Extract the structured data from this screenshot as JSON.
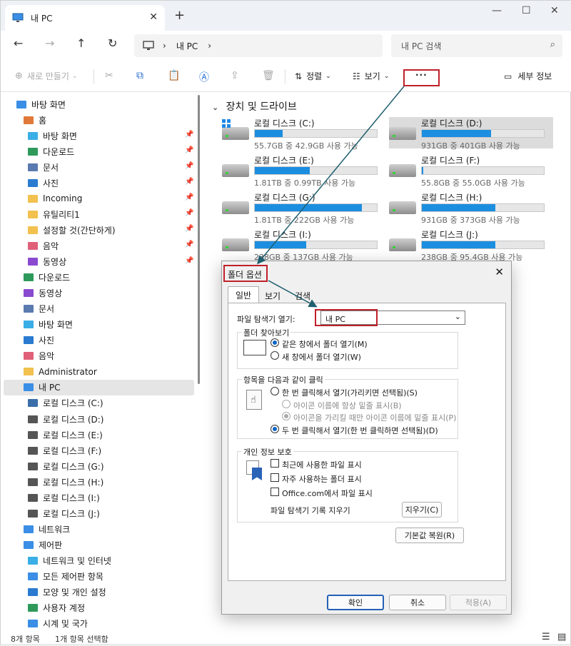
{
  "tab": {
    "title": "내 PC"
  },
  "address": {
    "segments": [
      "내 PC"
    ]
  },
  "search": {
    "placeholder": "내 PC 검색"
  },
  "toolbar": {
    "new": "새로 만들기",
    "sort": "정렬",
    "view": "보기",
    "more": "···",
    "details": "세부 정보"
  },
  "sidebar": {
    "items": [
      {
        "label": "바탕 화면",
        "icon": "desktop-icon",
        "color": "#3a8ee6",
        "indent": 0
      },
      {
        "label": "홈",
        "icon": "home-icon",
        "color": "#e07a3a",
        "indent": 1
      },
      {
        "label": "바탕 화면",
        "icon": "desktop-icon",
        "color": "#3aaee6",
        "indent": 2,
        "pinned": true
      },
      {
        "label": "다운로드",
        "icon": "download-icon",
        "color": "#2e9a5a",
        "indent": 2,
        "pinned": true
      },
      {
        "label": "문서",
        "icon": "document-icon",
        "color": "#5a7ab0",
        "indent": 2,
        "pinned": true
      },
      {
        "label": "사진",
        "icon": "pictures-icon",
        "color": "#2a7ad0",
        "indent": 2,
        "pinned": true
      },
      {
        "label": "Incoming",
        "icon": "folder-icon",
        "color": "#f2c14e",
        "indent": 2,
        "pinned": true
      },
      {
        "label": "유틸리티1",
        "icon": "folder-icon",
        "color": "#f2c14e",
        "indent": 2,
        "pinned": true
      },
      {
        "label": "설정할 것(간단하게)",
        "icon": "folder-icon",
        "color": "#f2c14e",
        "indent": 2,
        "pinned": true
      },
      {
        "label": "음악",
        "icon": "music-icon",
        "color": "#e0607a",
        "indent": 2,
        "pinned": true
      },
      {
        "label": "동영상",
        "icon": "video-icon",
        "color": "#8a4ad0",
        "indent": 2,
        "pinned": true
      },
      {
        "label": "다운로드",
        "icon": "download-icon",
        "color": "#2e9a5a",
        "indent": 1
      },
      {
        "label": "동영상",
        "icon": "video-icon",
        "color": "#8a4ad0",
        "indent": 1
      },
      {
        "label": "문서",
        "icon": "document-icon",
        "color": "#5a7ab0",
        "indent": 1
      },
      {
        "label": "바탕 화면",
        "icon": "desktop-icon",
        "color": "#3aaee6",
        "indent": 1
      },
      {
        "label": "사진",
        "icon": "pictures-icon",
        "color": "#2a7ad0",
        "indent": 1
      },
      {
        "label": "음악",
        "icon": "music-icon",
        "color": "#e0607a",
        "indent": 1
      },
      {
        "label": "Administrator",
        "icon": "folder-icon",
        "color": "#f2c14e",
        "indent": 1
      },
      {
        "label": "내 PC",
        "icon": "pc-icon",
        "color": "#3a8ee6",
        "indent": 1,
        "selected": true
      },
      {
        "label": "로컬 디스크 (C:)",
        "icon": "windows-drive-icon",
        "color": "#3a6ea8",
        "indent": 2
      },
      {
        "label": "로컬 디스크 (D:)",
        "icon": "drive-icon",
        "color": "#555555",
        "indent": 2
      },
      {
        "label": "로컬 디스크 (E:)",
        "icon": "drive-icon",
        "color": "#555555",
        "indent": 2
      },
      {
        "label": "로컬 디스크 (F:)",
        "icon": "drive-icon",
        "color": "#555555",
        "indent": 2
      },
      {
        "label": "로컬 디스크 (G:)",
        "icon": "drive-icon",
        "color": "#555555",
        "indent": 2
      },
      {
        "label": "로컬 디스크 (H:)",
        "icon": "drive-icon",
        "color": "#555555",
        "indent": 2
      },
      {
        "label": "로컬 디스크 (I:)",
        "icon": "drive-icon",
        "color": "#555555",
        "indent": 2
      },
      {
        "label": "로컬 디스크 (J:)",
        "icon": "drive-icon",
        "color": "#555555",
        "indent": 2
      },
      {
        "label": "네트워크",
        "icon": "network-icon",
        "color": "#3a8ee6",
        "indent": 1
      },
      {
        "label": "제어판",
        "icon": "control-panel-icon",
        "color": "#3a8ee6",
        "indent": 1
      },
      {
        "label": "네트워크 및 인터넷",
        "icon": "network-internet-icon",
        "color": "#3aaee6",
        "indent": 2
      },
      {
        "label": "모든 제어판 항목",
        "icon": "control-panel-icon",
        "color": "#3a8ee6",
        "indent": 2
      },
      {
        "label": "모양 및 개인 설정",
        "icon": "appearance-icon",
        "color": "#2a7ad0",
        "indent": 2
      },
      {
        "label": "사용자 계정",
        "icon": "user-accounts-icon",
        "color": "#2e9a5a",
        "indent": 2
      },
      {
        "label": "시계 및 국가",
        "icon": "clock-region-icon",
        "color": "#3a8ee6",
        "indent": 2
      }
    ]
  },
  "main": {
    "section_title": "장치 및 드라이브",
    "drives": [
      {
        "name": "로컬 디스크 (C:)",
        "size": "55.7GB 중 42.9GB 사용 가능",
        "used": 0.23,
        "system": true
      },
      {
        "name": "로컬 디스크 (D:)",
        "size": "931GB 중 401GB 사용 가능",
        "used": 0.57,
        "selected": true
      },
      {
        "name": "로컬 디스크 (E:)",
        "size": "1.81TB 중 0.99TB 사용 가능",
        "used": 0.45
      },
      {
        "name": "로컬 디스크 (F:)",
        "size": "55.8GB 중 55.0GB 사용 가능",
        "used": 0.01
      },
      {
        "name": "로컬 디스크 (G:)",
        "size": "1.81TB 중 222GB 사용 가능",
        "used": 0.88
      },
      {
        "name": "로컬 디스크 (H:)",
        "size": "931GB 중 373GB 사용 가능",
        "used": 0.6
      },
      {
        "name": "로컬 디스크 (I:)",
        "size": "238GB 중 137GB 사용 가능",
        "used": 0.42
      },
      {
        "name": "로컬 디스크 (J:)",
        "size": "238GB 중 95.4GB 사용 가능",
        "used": 0.6
      }
    ]
  },
  "status": {
    "items": "8개 항목",
    "selected": "1개 항목 선택함"
  },
  "dialog": {
    "title": "폴더 옵션",
    "tabs": [
      "일반",
      "보기",
      "검색"
    ],
    "open_label": "파일 탐색기 열기:",
    "open_value": "내 PC",
    "browse_group": "폴더 찾아보기",
    "browse_same": "같은 창에서 폴더 열기(M)",
    "browse_new": "새 창에서 폴더 열기(W)",
    "click_group": "항목을 다음과 같이 클릭",
    "single_click": "한 번 클릭해서 열기(가리키면 선택됨)(S)",
    "underline_always": "아이콘 이름에 항상 밑줄 표시(B)",
    "underline_hover": "아이콘을 가리킬 때만 아이콘 이름에 밑줄 표시(P)",
    "double_click": "두 번 클릭해서 열기(한 번 클릭하면 선택됨)(D)",
    "privacy_group": "개인 정보 보호",
    "show_recent": "최근에 사용한 파일 표시",
    "show_frequent": "자주 사용하는 폴더 표시",
    "show_office": "Office.com에서 파일 표시",
    "clear_history": "파일 탐색기 기록 지우기",
    "clear_btn": "지우기(C)",
    "restore_btn": "기본값 복원(R)",
    "ok": "확인",
    "cancel": "취소",
    "apply": "적용(A)"
  },
  "colors": {
    "accent": "#1c8ee0",
    "highlight_box": "#c0202a",
    "arrow": "#1f5f6e"
  }
}
